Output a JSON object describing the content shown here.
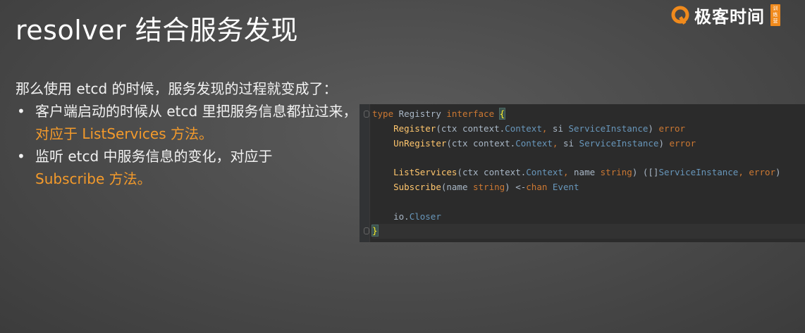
{
  "slide": {
    "title": "resolver 结合服务发现"
  },
  "brand": {
    "name": "极客时间",
    "badge": "训练营",
    "accent": "#f08a1c"
  },
  "content": {
    "intro": "那么使用 etcd 的时候，服务发现的过程就变成了：",
    "bullets": [
      {
        "marker": "•",
        "text": "客户端启动的时候从 etcd 里把服务信息都拉过来，",
        "highlight": "对应于 ListServices 方法。"
      },
      {
        "marker": "•",
        "text": "监听 etcd 中服务信息的变化，对应于",
        "highlight": "Subscribe 方法。"
      }
    ],
    "highlight_color": "#f39a2b"
  },
  "code": {
    "lines": [
      [
        {
          "t": "type",
          "c": "kw"
        },
        {
          "t": " Registry ",
          "c": "id"
        },
        {
          "t": "interface",
          "c": "kw"
        },
        {
          "t": " ",
          "c": "id"
        },
        {
          "t": "{",
          "c": "brace match"
        }
      ],
      [
        {
          "t": "    ",
          "c": "id"
        },
        {
          "t": "Register",
          "c": "fn"
        },
        {
          "t": "(ctx context.",
          "c": "id"
        },
        {
          "t": "Context",
          "c": "ty"
        },
        {
          "t": ", ",
          "c": "kw"
        },
        {
          "t": "si ",
          "c": "id"
        },
        {
          "t": "ServiceInstance",
          "c": "ty"
        },
        {
          "t": ") ",
          "c": "id"
        },
        {
          "t": "error",
          "c": "kw"
        }
      ],
      [
        {
          "t": "    ",
          "c": "id"
        },
        {
          "t": "UnRegister",
          "c": "fn"
        },
        {
          "t": "(ctx context.",
          "c": "id"
        },
        {
          "t": "Context",
          "c": "ty"
        },
        {
          "t": ", ",
          "c": "kw"
        },
        {
          "t": "si ",
          "c": "id"
        },
        {
          "t": "ServiceInstance",
          "c": "ty"
        },
        {
          "t": ") ",
          "c": "id"
        },
        {
          "t": "error",
          "c": "kw"
        }
      ],
      [],
      [
        {
          "t": "    ",
          "c": "id"
        },
        {
          "t": "ListServices",
          "c": "fn"
        },
        {
          "t": "(ctx context.",
          "c": "id"
        },
        {
          "t": "Context",
          "c": "ty"
        },
        {
          "t": ", ",
          "c": "kw"
        },
        {
          "t": "name ",
          "c": "id"
        },
        {
          "t": "string",
          "c": "kw"
        },
        {
          "t": ") ([]",
          "c": "id"
        },
        {
          "t": "ServiceInstance",
          "c": "ty"
        },
        {
          "t": ", ",
          "c": "kw"
        },
        {
          "t": "error",
          "c": "kw"
        },
        {
          "t": ")",
          "c": "id"
        }
      ],
      [
        {
          "t": "    ",
          "c": "id"
        },
        {
          "t": "Subscribe",
          "c": "fn"
        },
        {
          "t": "(name ",
          "c": "id"
        },
        {
          "t": "string",
          "c": "kw"
        },
        {
          "t": ") <-",
          "c": "id"
        },
        {
          "t": "chan",
          "c": "kw"
        },
        {
          "t": " ",
          "c": "id"
        },
        {
          "t": "Event",
          "c": "ty"
        }
      ],
      [],
      [
        {
          "t": "    io.",
          "c": "id"
        },
        {
          "t": "Closer",
          "c": "ty"
        }
      ],
      [
        {
          "t": "}",
          "c": "brace match"
        },
        {
          "t": "",
          "c": "caret"
        }
      ]
    ],
    "current_line": 8
  }
}
